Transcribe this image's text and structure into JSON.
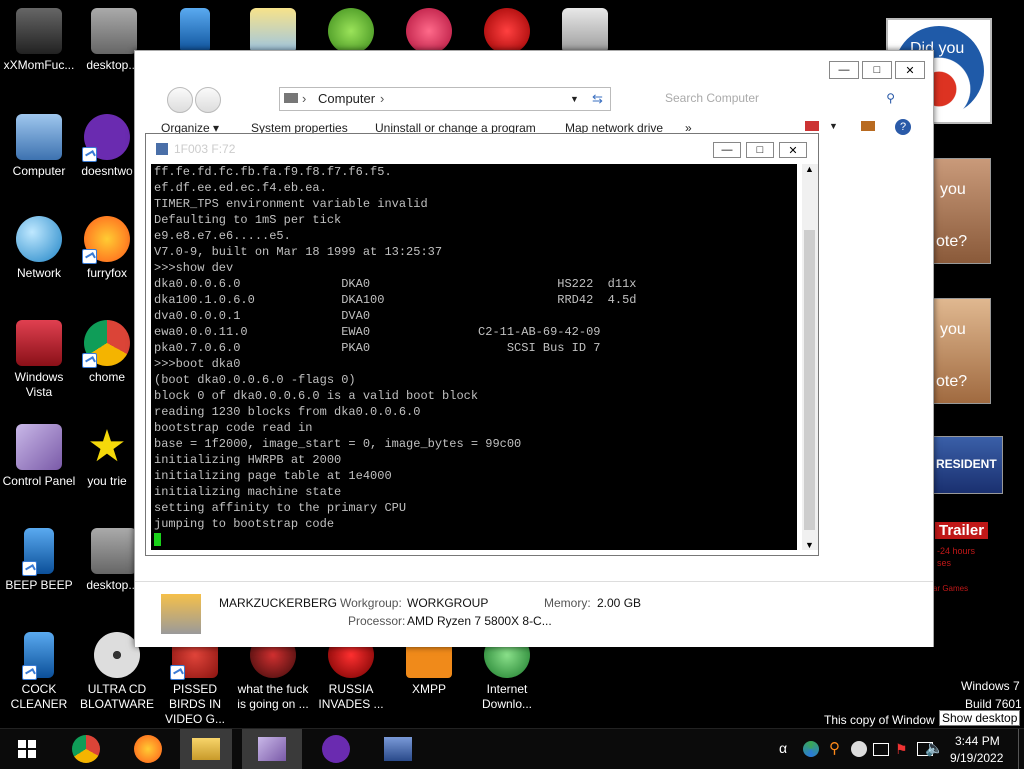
{
  "desktop_icons": [
    {
      "label": "xXMomFuc...",
      "color": "#555"
    },
    {
      "label": "desktop....",
      "color": "#888"
    },
    {
      "label": "Computer",
      "color": "#4a8ac9"
    },
    {
      "label": "doesntwo",
      "color": "#6a2bb0"
    },
    {
      "label": "Network",
      "color": "#2aa0d8"
    },
    {
      "label": "furryfox",
      "color": "#ff7a1a"
    },
    {
      "label": "Windows Vista",
      "color": "#c0202a"
    },
    {
      "label": "chome",
      "color": "#3aa757"
    },
    {
      "label": "Control Panel",
      "color": "#9a7ab8"
    },
    {
      "label": "you trie",
      "color": "#f5d90a"
    },
    {
      "label": "BEEP BEEP",
      "color": "#1e78c8"
    },
    {
      "label": "desktop....",
      "color": "#888"
    },
    {
      "label": "COCK CLEANER",
      "color": "#1e78c8"
    },
    {
      "label": "ULTRA CD BLOATWARE",
      "color": "#bbbbbb"
    },
    {
      "label": "PISSED BIRDS IN VIDEO G...",
      "color": "#d23a2a"
    },
    {
      "label": "what the fuck is going on ...",
      "color": "#c82020"
    },
    {
      "label": "RUSSIA INVADES ...",
      "color": "#c00000"
    },
    {
      "label": "XMPP",
      "color": "#f08a1a"
    },
    {
      "label": "Internet Downlo...",
      "color": "#2a9a3a"
    }
  ],
  "explorer": {
    "address": "Computer",
    "search_placeholder": "Search Computer",
    "toolbar": [
      "Organize ▾",
      "System properties",
      "Uninstall or change a program",
      "Map network drive",
      "»"
    ],
    "computer_name": "MARKZUCKERBERG",
    "workgroup_label": "Workgroup:",
    "workgroup": "WORKGROUP",
    "memory_label": "Memory:",
    "memory": "2.00 GB",
    "processor_label": "Processor:",
    "processor": "AMD Ryzen 7 5800X 8-C..."
  },
  "console": {
    "title": "1F003 F:72",
    "lines": [
      "ff.fe.fd.fc.fb.fa.f9.f8.f7.f6.f5.",
      "ef.df.ee.ed.ec.f4.eb.ea.",
      "TIMER_TPS environment variable invalid",
      "Defaulting to 1mS per tick",
      "e9.e8.e7.e6.....e5.",
      "V7.0-9, built on Mar 18 1999 at 13:25:37",
      ">>>show dev",
      "dka0.0.0.6.0              DKA0                          HS222  d11x",
      "dka100.1.0.6.0            DKA100                        RRD42  4.5d",
      "dva0.0.0.0.1              DVA0",
      "ewa0.0.0.11.0             EWA0               C2-11-AB-69-42-09",
      "pka0.7.0.6.0              PKA0                   SCSI Bus ID 7",
      ">>>boot dka0",
      "(boot dka0.0.0.6.0 -flags 0)",
      "block 0 of dka0.0.0.6.0 is a valid boot block",
      "reading 1230 blocks from dka0.0.0.6.0",
      "bootstrap code read in",
      "base = 1f2000, image_start = 0, image_bytes = 99c00",
      "initializing HWRPB at 2000",
      "initializing page table at 1e4000",
      "initializing machine state",
      "setting affinity to the primary CPU",
      "jumping to bootstrap code"
    ]
  },
  "right_panels": {
    "p1": "Did you",
    "p2a": "you",
    "p2b": "ote?",
    "p3a": "you",
    "p3b": "ote?",
    "president": "RESIDENT",
    "trailer": "Trailer",
    "trailer_sub1": "-24 hours",
    "trailer_sub2": "ses",
    "trailer_sub3": "ar Games"
  },
  "watermark": {
    "os": "Windows 7",
    "build": "Build 7601",
    "copy": "This copy of Window",
    "show_desktop": "Show desktop"
  },
  "taskbar": {
    "time": "3:44 PM",
    "date": "9/19/2022"
  }
}
